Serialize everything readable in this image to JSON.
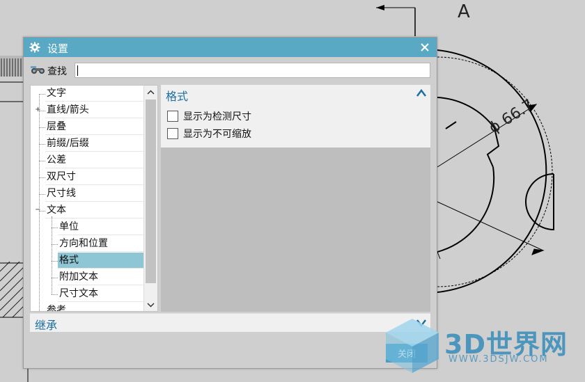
{
  "background": {
    "section_label": "A",
    "dimension_label": "ϕ 66.7"
  },
  "dialog": {
    "title": "设置",
    "close_symbol": "✕",
    "search": {
      "label": "查找",
      "value": ""
    },
    "tree": {
      "items": [
        {
          "label": "文字",
          "level": 0,
          "expander": ""
        },
        {
          "label": "直线/箭头",
          "level": 0,
          "expander": "+"
        },
        {
          "label": "层叠",
          "level": 0,
          "expander": ""
        },
        {
          "label": "前缀/后缀",
          "level": 0,
          "expander": ""
        },
        {
          "label": "公差",
          "level": 0,
          "expander": ""
        },
        {
          "label": "双尺寸",
          "level": 0,
          "expander": ""
        },
        {
          "label": "尺寸线",
          "level": 0,
          "expander": ""
        },
        {
          "label": "文本",
          "level": 0,
          "expander": "−"
        },
        {
          "label": "单位",
          "level": 1,
          "expander": ""
        },
        {
          "label": "方向和位置",
          "level": 1,
          "expander": ""
        },
        {
          "label": "格式",
          "level": 1,
          "expander": "",
          "selected": true
        },
        {
          "label": "附加文本",
          "level": 1,
          "expander": ""
        },
        {
          "label": "尺寸文本",
          "level": 1,
          "expander": ""
        },
        {
          "label": "参考",
          "level": 0,
          "expander": ""
        }
      ]
    },
    "format_section": {
      "title": "格式",
      "options": [
        {
          "label": "显示为检测尺寸",
          "checked": false
        },
        {
          "label": "显示为不可缩放",
          "checked": false
        }
      ]
    },
    "inherit_section": {
      "title": "继承"
    },
    "close_button_label": "关闭"
  },
  "watermark": {
    "name": "3D世界网",
    "url": "WWW.3DSJW.COM"
  },
  "colors": {
    "titlebar": "#5aa9c4",
    "section_title": "#1b6fa0",
    "selected_item": "#8fc6d6",
    "close_button": "#4a9ec6"
  }
}
